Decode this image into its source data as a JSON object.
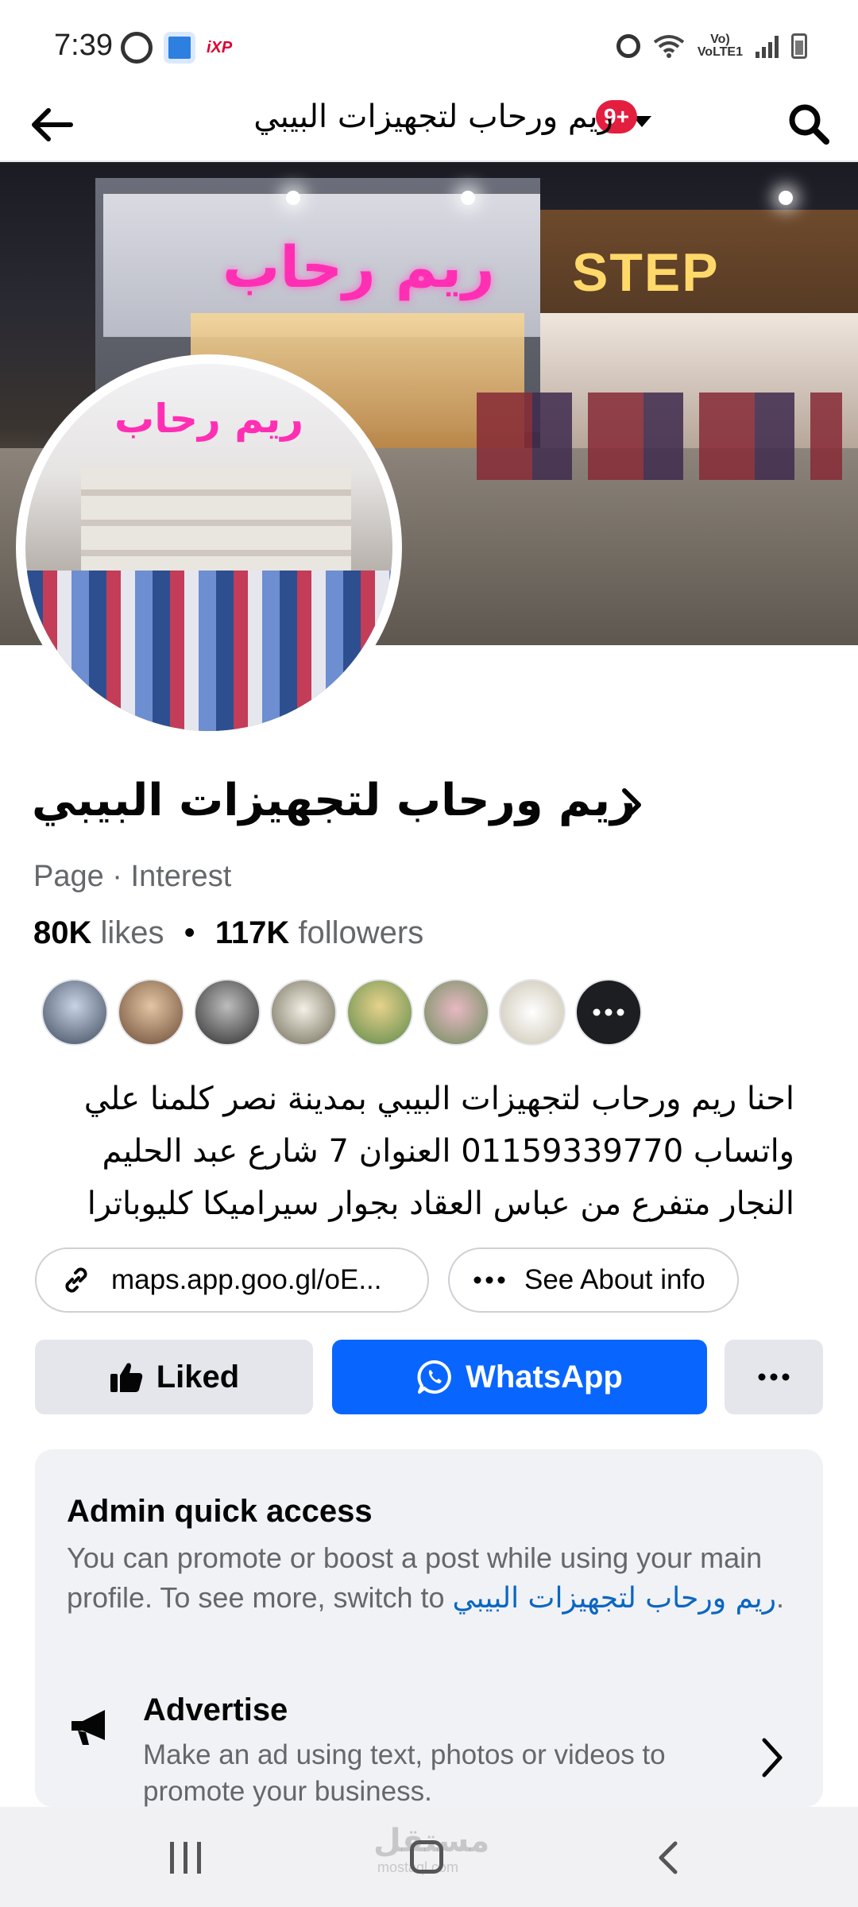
{
  "status_bar": {
    "time": "7:39",
    "network_label": "VoLTE1"
  },
  "app_bar": {
    "title": "ريم ورحاب لتجهيزات البيبي",
    "notification_count": "9+"
  },
  "page": {
    "name": "ريم ورحاب لتجهيزات البيبي",
    "category": "Page · Interest",
    "likes_count": "80K",
    "likes_label": "likes",
    "followers_count": "117K",
    "followers_label": "followers",
    "bio_line1": "احنا ريم ورحاب لتجهيزات البيبي بمدينة نصر  كلمنا علي",
    "bio_line2": "واتساب 01159339770 العنوان 7 شارع عبد الحليم",
    "bio_line3": "النجار متفرع من عباس العقاد بجوار سيراميكا كليوباترا"
  },
  "chips": {
    "map_link": "maps.app.goo.gl/oE...",
    "about": "See About info"
  },
  "actions": {
    "liked": "Liked",
    "whatsapp": "WhatsApp"
  },
  "admin": {
    "title": "Admin quick access",
    "desc_prefix": "You can promote or boost a post while using your main profile. To see more, switch to ",
    "desc_link": "ريم ورحاب لتجهيزات البيبي",
    "desc_suffix": ".",
    "advertise_title": "Advertise",
    "advertise_desc": "Make an ad using text, photos or videos to promote your business."
  },
  "watermark": {
    "text": "مستقل",
    "sub": "mostaql.com"
  },
  "colors": {
    "primary_blue": "#0866ff",
    "badge_red": "#e41e3f",
    "secondary_text": "#65676b"
  },
  "icons": [
    "back-arrow-icon",
    "search-icon",
    "caret-down-icon",
    "chevron-right-icon",
    "link-icon",
    "more-dots-icon",
    "thumbs-up-icon",
    "whatsapp-icon",
    "megaphone-icon"
  ]
}
